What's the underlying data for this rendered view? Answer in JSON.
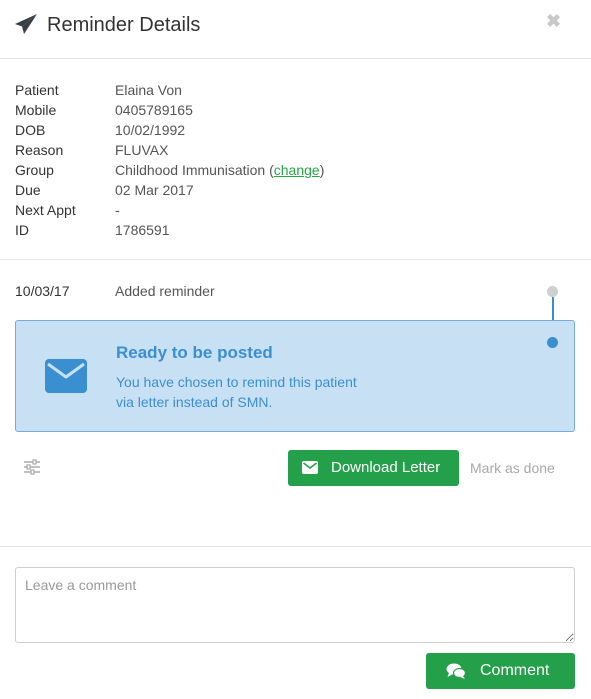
{
  "header": {
    "icon": "paper-plane-icon",
    "title": "Reminder Details",
    "close_icon": "close-icon",
    "close_glyph": "✖"
  },
  "details": [
    {
      "key": "Patient",
      "value": "Elaina Von"
    },
    {
      "key": "Mobile",
      "value": "0405789165"
    },
    {
      "key": "DOB",
      "value": "10/02/1992"
    },
    {
      "key": "Reason",
      "value": "FLUVAX"
    },
    {
      "key": "Group",
      "value": "Childhood Immunisation",
      "action_prefix": " (",
      "action": "change",
      "action_suffix": ")"
    },
    {
      "key": "Due",
      "value": "02 Mar 2017"
    },
    {
      "key": "Next Appt",
      "value": "-"
    },
    {
      "key": "ID",
      "value": "1786591"
    }
  ],
  "timeline": {
    "entries": [
      {
        "date": "10/03/17",
        "text": "Added reminder"
      }
    ]
  },
  "status": {
    "icon": "envelope-icon",
    "title": "Ready to be posted",
    "line1": "You have chosen to remind this patient",
    "line2": "via letter instead of SMN."
  },
  "actions": {
    "settings_icon": "sliders-icon",
    "download_label": "Download Letter",
    "download_icon": "envelope-icon",
    "mark_done_label": "Mark as done"
  },
  "comment": {
    "placeholder": "Leave a comment",
    "value": "",
    "button_label": "Comment",
    "button_icon": "comments-icon"
  },
  "colors": {
    "accent_green": "#24a04a",
    "info_blue": "#3a8fd0",
    "info_bg": "#c8e0f4",
    "muted_gray": "#a8a8a8"
  }
}
